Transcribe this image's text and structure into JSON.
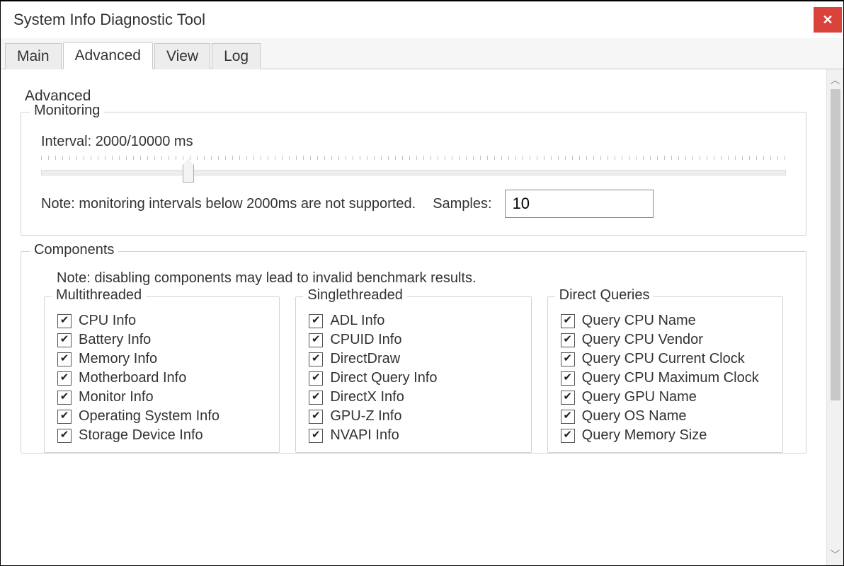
{
  "window": {
    "title": "System Info Diagnostic Tool"
  },
  "tabs": [
    {
      "label": "Main",
      "active": false
    },
    {
      "label": "Advanced",
      "active": true
    },
    {
      "label": "View",
      "active": false
    },
    {
      "label": "Log",
      "active": false
    }
  ],
  "page": {
    "heading": "Advanced"
  },
  "monitoring": {
    "legend": "Monitoring",
    "interval_label": "Interval: 2000/10000 ms",
    "slider": {
      "min": 0,
      "max": 10000,
      "value": 2000,
      "percent": 19
    },
    "note": "Note: monitoring intervals below 2000ms are not supported.",
    "samples_label": "Samples:",
    "samples_value": "10"
  },
  "components": {
    "legend": "Components",
    "note": "Note: disabling components may lead to invalid benchmark results.",
    "columns": [
      {
        "title": "Multithreaded",
        "items": [
          {
            "label": "CPU Info",
            "checked": true
          },
          {
            "label": "Battery Info",
            "checked": true
          },
          {
            "label": "Memory Info",
            "checked": true
          },
          {
            "label": "Motherboard Info",
            "checked": true
          },
          {
            "label": "Monitor Info",
            "checked": true
          },
          {
            "label": "Operating System Info",
            "checked": true
          },
          {
            "label": "Storage Device Info",
            "checked": true
          }
        ]
      },
      {
        "title": "Singlethreaded",
        "items": [
          {
            "label": "ADL Info",
            "checked": true
          },
          {
            "label": "CPUID Info",
            "checked": true
          },
          {
            "label": "DirectDraw",
            "checked": true
          },
          {
            "label": "Direct Query Info",
            "checked": true
          },
          {
            "label": "DirectX Info",
            "checked": true
          },
          {
            "label": "GPU-Z Info",
            "checked": true
          },
          {
            "label": "NVAPI Info",
            "checked": true
          }
        ]
      },
      {
        "title": "Direct Queries",
        "items": [
          {
            "label": "Query CPU Name",
            "checked": true
          },
          {
            "label": "Query CPU Vendor",
            "checked": true
          },
          {
            "label": "Query CPU Current Clock",
            "checked": true
          },
          {
            "label": "Query CPU Maximum Clock",
            "checked": true
          },
          {
            "label": "Query GPU Name",
            "checked": true
          },
          {
            "label": "Query OS Name",
            "checked": true
          },
          {
            "label": "Query Memory Size",
            "checked": true
          }
        ]
      }
    ]
  }
}
